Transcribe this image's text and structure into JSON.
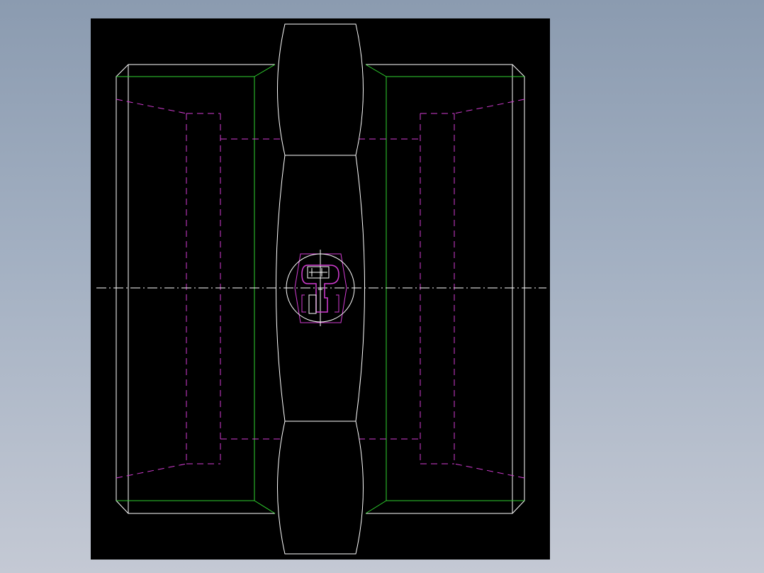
{
  "viewport": {
    "background": "#000000",
    "page_background_gradient": [
      "#8b9bb0",
      "#c4c9d4"
    ]
  },
  "colors": {
    "outline": "#ffffff",
    "chamfer_edge": "#2fd22f",
    "hidden_line": "#d23cd2",
    "centerline": "#ffffff"
  },
  "drawing": {
    "subject": "hex-nipple-fitting-front-view",
    "visible_text": []
  }
}
